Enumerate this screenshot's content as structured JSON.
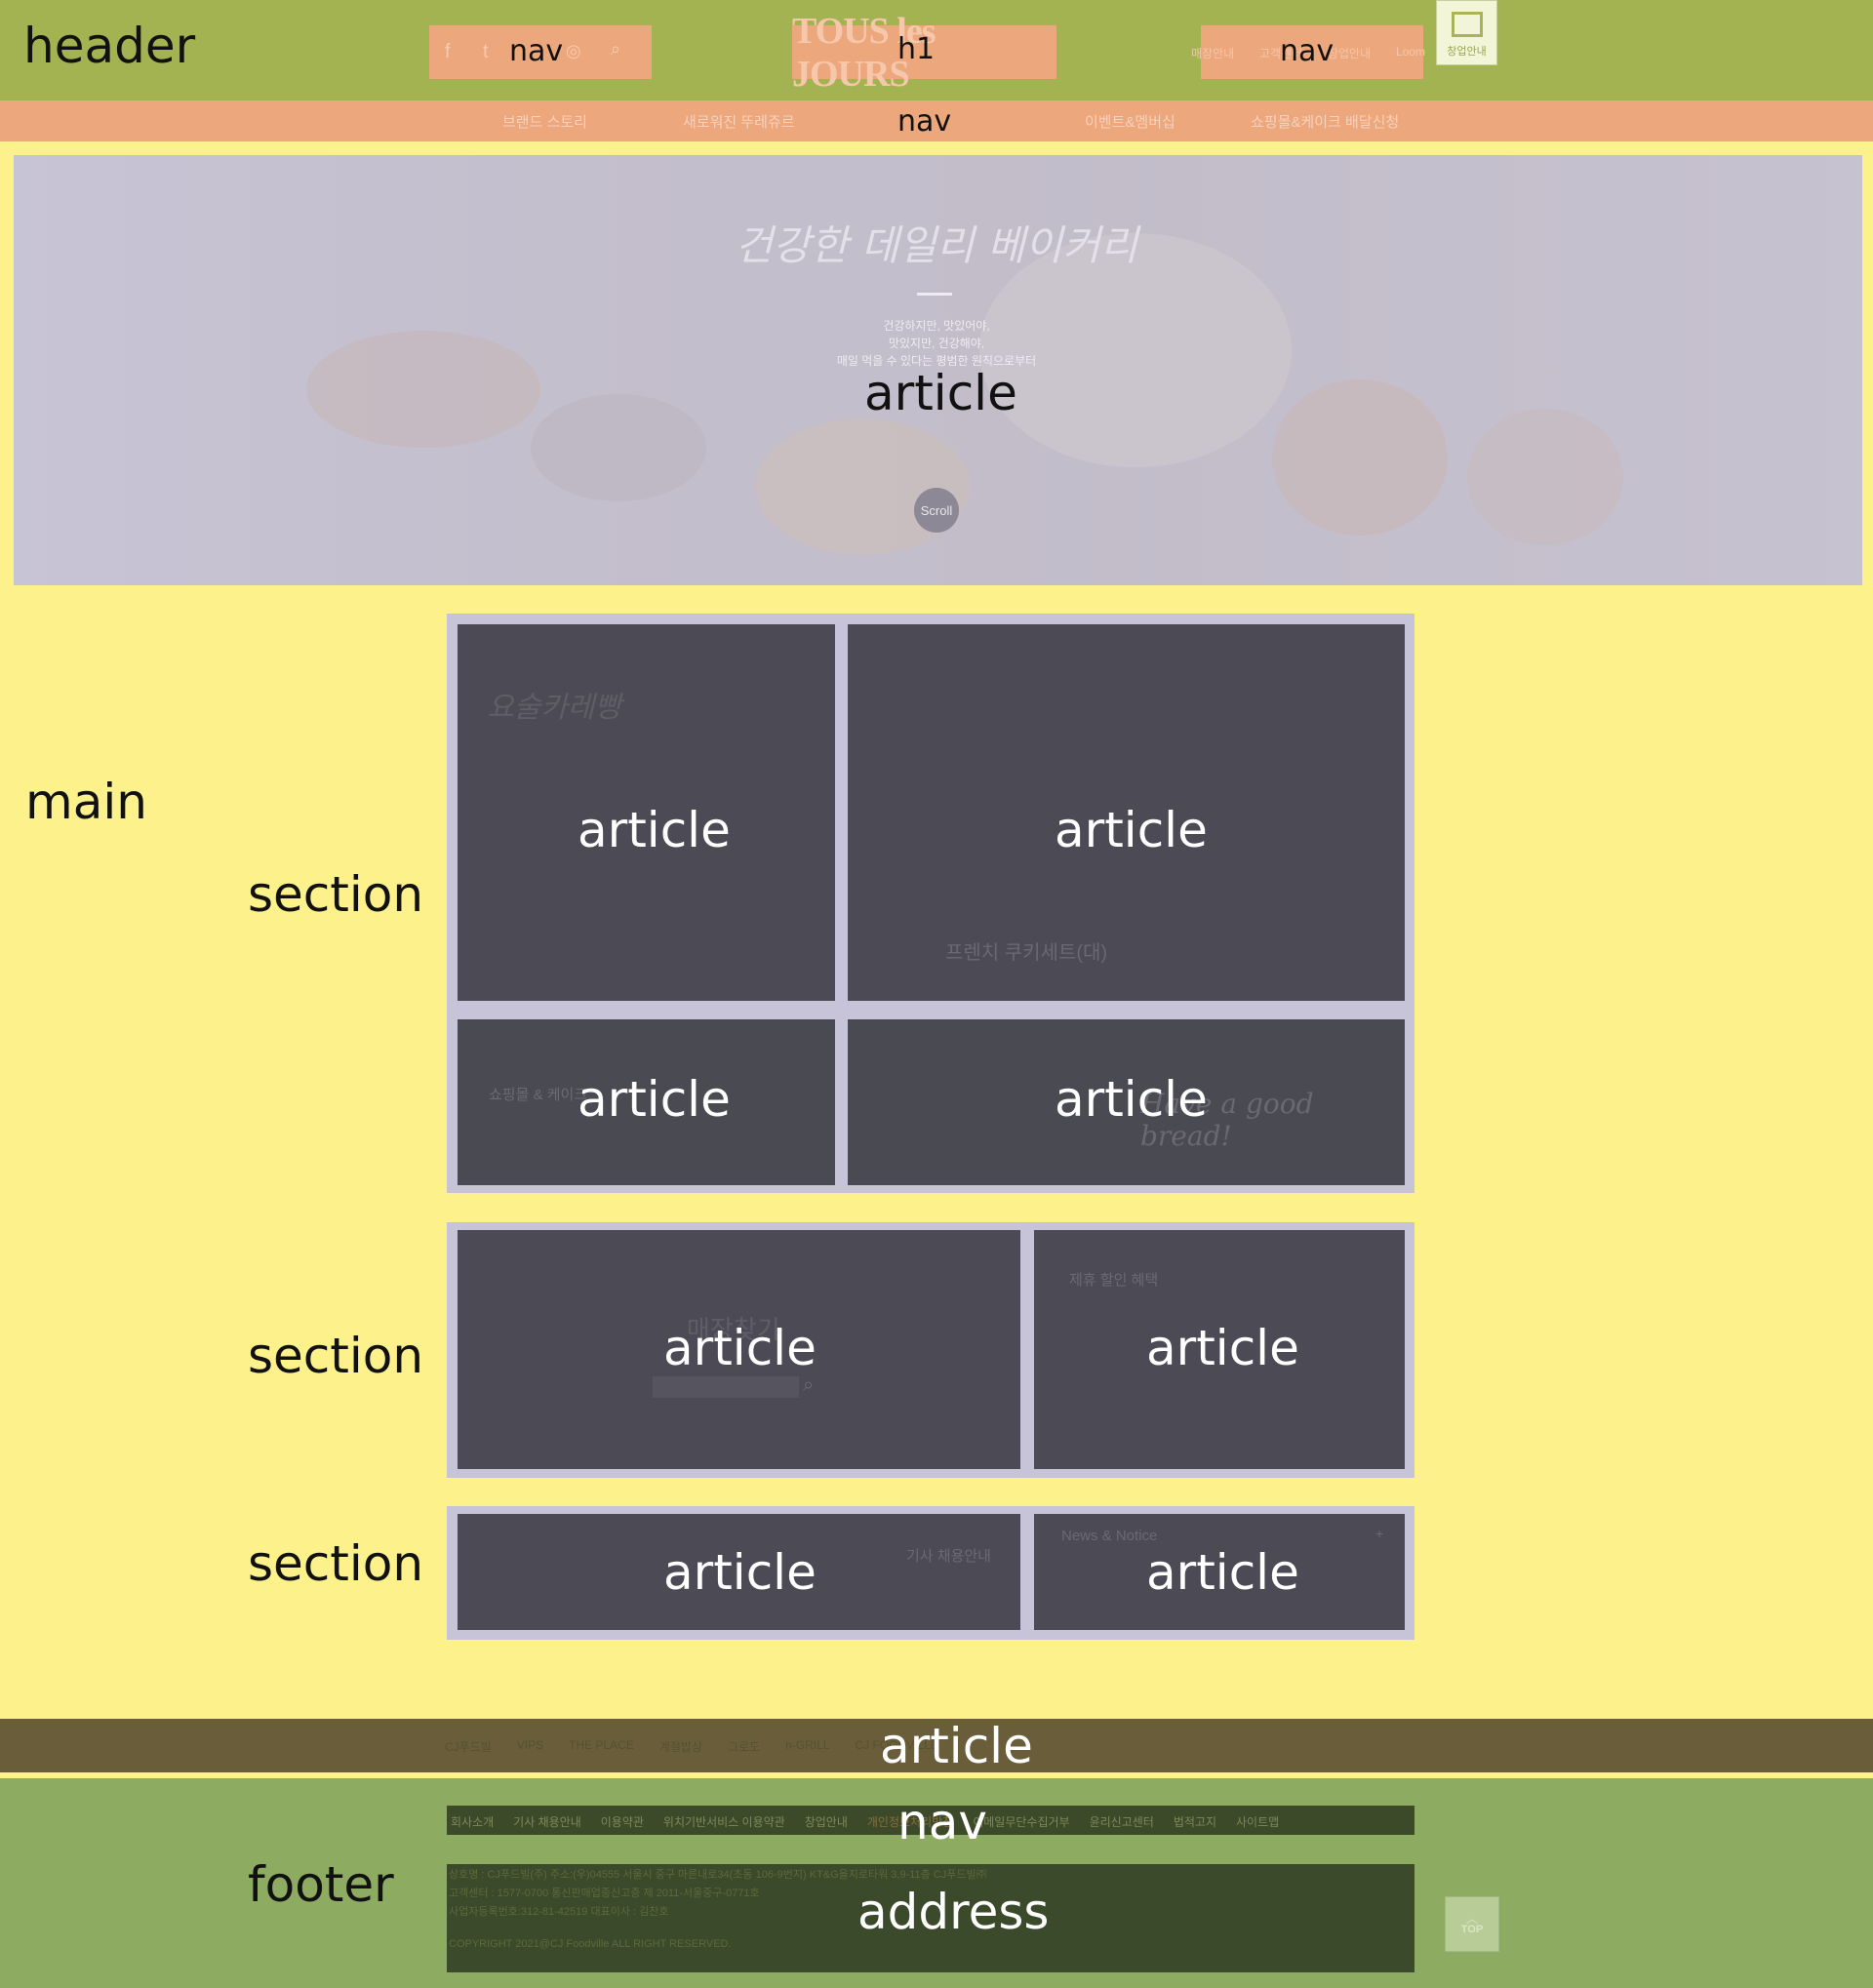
{
  "header": {
    "label": "header",
    "social_nav_label": "nav",
    "h1_label": "h1",
    "util_nav_label": "nav",
    "logo_text": "TOUS les JOURS",
    "shop_label": "창업안내",
    "util_links": [
      "매장안내",
      "고객센터",
      "창업안내",
      "Loom"
    ]
  },
  "menu": {
    "label": "nav",
    "items": [
      "브랜드 스토리",
      "새로워진 뚜레쥬르",
      "제품안내",
      "이벤트&멤버십",
      "쇼핑몰&케이크 배달신청"
    ]
  },
  "hero": {
    "label": "article",
    "headline": "건강한 데일리 베이커리",
    "lines": [
      "건강하지만, 맛있어야,",
      "맛있지만, 건강해야,",
      "매일 먹을 수 있다는 평범한 원칙으로부터"
    ],
    "scroll": "Scroll"
  },
  "main": {
    "label": "main",
    "sections": [
      {
        "label": "section",
        "articles": [
          {
            "label": "article",
            "caption": "요술카레빵"
          },
          {
            "label": "article",
            "caption": "프렌치 쿠키세트(대)"
          },
          {
            "label": "article",
            "caption": "쇼핑몰 & 케이크"
          },
          {
            "label": "article",
            "caption": "Have a good bread!"
          }
        ]
      },
      {
        "label": "section",
        "articles": [
          {
            "label": "article",
            "caption": "매장찾기"
          },
          {
            "label": "article",
            "caption": "제휴 할인 혜택"
          }
        ]
      },
      {
        "label": "section",
        "articles": [
          {
            "label": "article",
            "caption": "기사 채용안내"
          },
          {
            "label": "article",
            "caption": "News & Notice"
          }
        ]
      }
    ]
  },
  "partners": {
    "label": "article",
    "items": [
      "CJ푸드빌",
      "VIPS",
      "THE PLACE",
      "계절밥상",
      "그로도",
      "n-GRILL",
      "CJ FOODVILLE"
    ]
  },
  "footer": {
    "label": "footer",
    "nav_label": "nav",
    "address_label": "address",
    "links": [
      "회사소개",
      "기사 채용안내",
      "이용약관",
      "위치기반서비스 이용약관",
      "창업안내",
      "개인정보처리방침",
      "이메일무단수집거부",
      "윤리신고센터",
      "법적고지",
      "사이트맵"
    ],
    "address_lines": [
      "상호명 : CJ푸드빌(주) 주소:(우)04555 서울시 중구 마른내로34(초동 106-9번지) KT&G을지로타워 3,9-11층 CJ푸드빌㈜",
      "고객센터 : 1577-0700   통신판매업종신고증 제 2011-서울중구-0771호",
      "사업자등록번호:312-81-42519 대표이사 : 김찬호",
      "COPYRIGHT 2021@CJ Foodville ALL RIGHT RESERVED."
    ],
    "top_label": "TOP"
  }
}
